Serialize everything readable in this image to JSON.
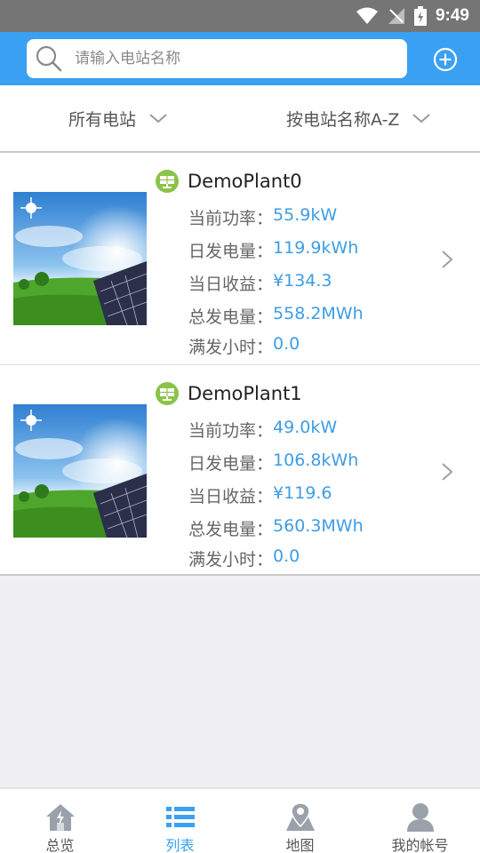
{
  "status_bar": {
    "time": "9:49"
  },
  "search": {
    "placeholder": "请输入电站名称"
  },
  "filters": {
    "all_label": "所有电站",
    "sort_label": "按电站名称A-Z"
  },
  "plants": [
    {
      "name": "DemoPlant0",
      "power_label": "当前功率：",
      "power": "55.9kW",
      "daily_energy_label": "日发电量：",
      "daily_energy": "119.9kWh",
      "daily_income_label": "当日收益：",
      "daily_income": "¥134.3",
      "total_energy_label": "总发电量：",
      "total_energy": "558.2MWh",
      "full_hours_label": "满发小时：",
      "full_hours": "0.0"
    },
    {
      "name": "DemoPlant1",
      "power_label": "当前功率：",
      "power": "49.0kW",
      "daily_energy_label": "日发电量：",
      "daily_energy": "106.8kWh",
      "daily_income_label": "当日收益：",
      "daily_income": "¥119.6",
      "total_energy_label": "总发电量：",
      "total_energy": "560.3MWh",
      "full_hours_label": "满发小时：",
      "full_hours": "0.0"
    }
  ],
  "nav": {
    "overview": "总览",
    "list": "列表",
    "map": "地图",
    "account": "我的帐号",
    "active": "list"
  },
  "colors": {
    "accent": "#3aa0f2",
    "value_text": "#3d9de4",
    "status_bar": "#757575"
  }
}
